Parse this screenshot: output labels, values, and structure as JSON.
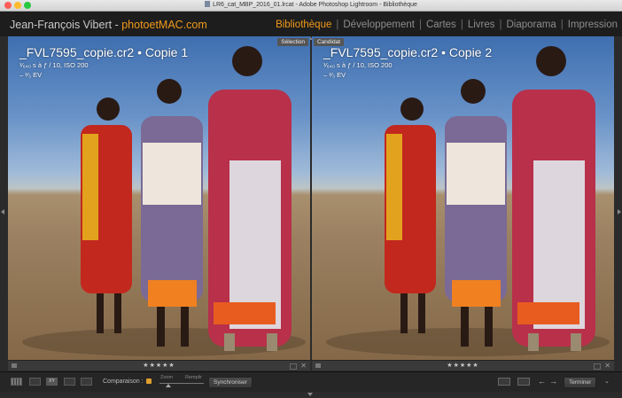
{
  "window": {
    "title": "LR6_cat_MBP_2016_01.lrcat - Adobe Photoshop Lightroom - Bibliothèque"
  },
  "identity": {
    "owner": "Jean-François Vibert - ",
    "brand": "photoetMAC.com"
  },
  "modules": [
    {
      "label": "Bibliothèque",
      "active": true
    },
    {
      "label": "Développement",
      "active": false
    },
    {
      "label": "Cartes",
      "active": false
    },
    {
      "label": "Livres",
      "active": false
    },
    {
      "label": "Diaporama",
      "active": false
    },
    {
      "label": "Impression",
      "active": false
    }
  ],
  "compare": {
    "left": {
      "tag": "Sélection",
      "filename": "_FVL7595_copie.cr2 • Copie 1",
      "exposure_line": "¹⁄₆₄₀ s à ƒ / 10, ISO 200",
      "ev_line": "– ²⁄₃ EV",
      "stars": "★★★★★"
    },
    "right": {
      "tag": "Candidat",
      "filename": "_FVL7595_copie.cr2 • Copie 2",
      "exposure_line": "¹⁄₆₄₀ s à ƒ / 10, ISO 200",
      "ev_line": "– ²⁄₃ EV",
      "stars": "★★★★★"
    }
  },
  "toolbar": {
    "compare_view_label": "XY",
    "comparison_label": "Comparaison :",
    "zoom_label": "Zoom",
    "fill_label": "Remplir",
    "sync_label": "Synchroniser",
    "done_label": "Terminer",
    "close_glyph": "✕",
    "prev_glyph": "←",
    "next_glyph": "→",
    "menu_glyph": "⌄"
  },
  "icons": {
    "grid": "grid-view-icon",
    "loupe": "loupe-view-icon",
    "compare": "compare-view-icon",
    "survey": "survey-view-icon",
    "people": "people-view-icon",
    "lock": "lock-icon",
    "swap": "swap-icon",
    "promote": "make-select-icon"
  },
  "colors": {
    "accent": "#f29a1a",
    "background": "#2b2b2b"
  }
}
